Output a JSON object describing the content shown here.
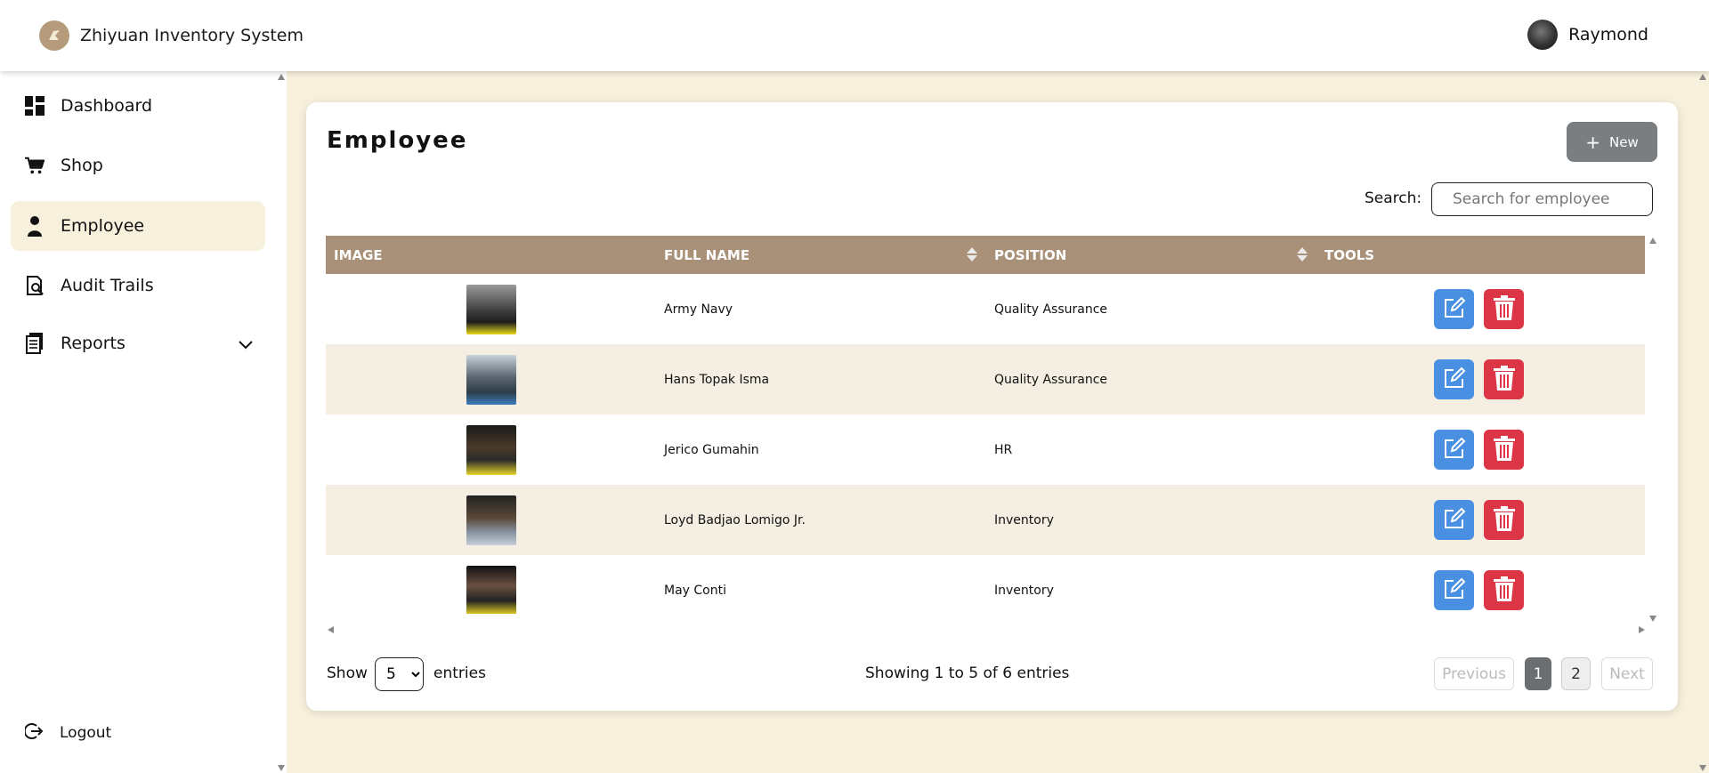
{
  "app": {
    "title": "Zhiyuan Inventory System",
    "user_name": "Raymond"
  },
  "sidebar": {
    "items": [
      {
        "label": "Dashboard",
        "icon": "dashboard-icon"
      },
      {
        "label": "Shop",
        "icon": "cart-icon"
      },
      {
        "label": "Employee",
        "icon": "person-icon",
        "active": true
      },
      {
        "label": "Audit Trails",
        "icon": "audit-icon"
      },
      {
        "label": "Reports",
        "icon": "reports-icon"
      }
    ],
    "logout_label": "Logout"
  },
  "page": {
    "title": "Employee",
    "new_button_label": "New",
    "search_label": "Search:",
    "search_placeholder": "Search for employee",
    "search_value": ""
  },
  "table": {
    "columns": [
      "IMAGE",
      "FULL NAME",
      "POSITION",
      "TOOLS"
    ],
    "rows": [
      {
        "name": "Army Navy",
        "position": "Quality Assurance"
      },
      {
        "name": "Hans Topak Isma",
        "position": "Quality Assurance"
      },
      {
        "name": "Jerico Gumahin",
        "position": "HR"
      },
      {
        "name": "Loyd Badjao Lomigo Jr.",
        "position": "Inventory"
      },
      {
        "name": "May Conti",
        "position": "Inventory"
      }
    ]
  },
  "footer": {
    "show_label": "Show",
    "page_size": "5",
    "entries_label": "entries",
    "info": "Showing 1 to 5 of 6 entries",
    "previous_label": "Previous",
    "pages": [
      "1",
      "2"
    ],
    "next_label": "Next"
  },
  "colors": {
    "accent_cream": "#f7f0dc",
    "table_header": "#a89178",
    "edit_blue": "#4a90e2",
    "delete_red": "#dc3545",
    "new_button_gray": "#7b7e80"
  }
}
